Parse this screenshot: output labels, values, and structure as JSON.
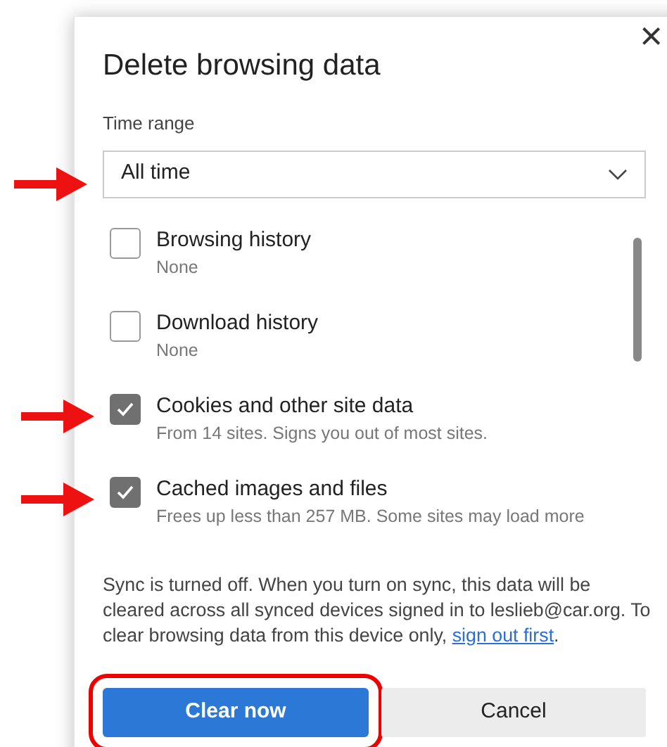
{
  "dialog": {
    "title": "Delete browsing data",
    "close": "×"
  },
  "time_range": {
    "label": "Time range",
    "value": "All time"
  },
  "items": [
    {
      "label": "Browsing history",
      "detail": "None",
      "checked": false
    },
    {
      "label": "Download history",
      "detail": "None",
      "checked": false
    },
    {
      "label": "Cookies and other site data",
      "detail": "From 14 sites. Signs you out of most sites.",
      "checked": true
    },
    {
      "label": "Cached images and files",
      "detail": "Frees up less than 257 MB. Some sites may load more",
      "checked": true
    }
  ],
  "sync_note": {
    "text": "Sync is turned off. When you turn on sync, this data will be cleared across all synced devices signed in to leslieb@car.org. To clear browsing data from this device only, ",
    "link": "sign out first",
    "end": "."
  },
  "buttons": [
    {
      "label": "Clear now",
      "kind": "primary"
    },
    {
      "label": "Cancel",
      "kind": "secondary"
    }
  ]
}
